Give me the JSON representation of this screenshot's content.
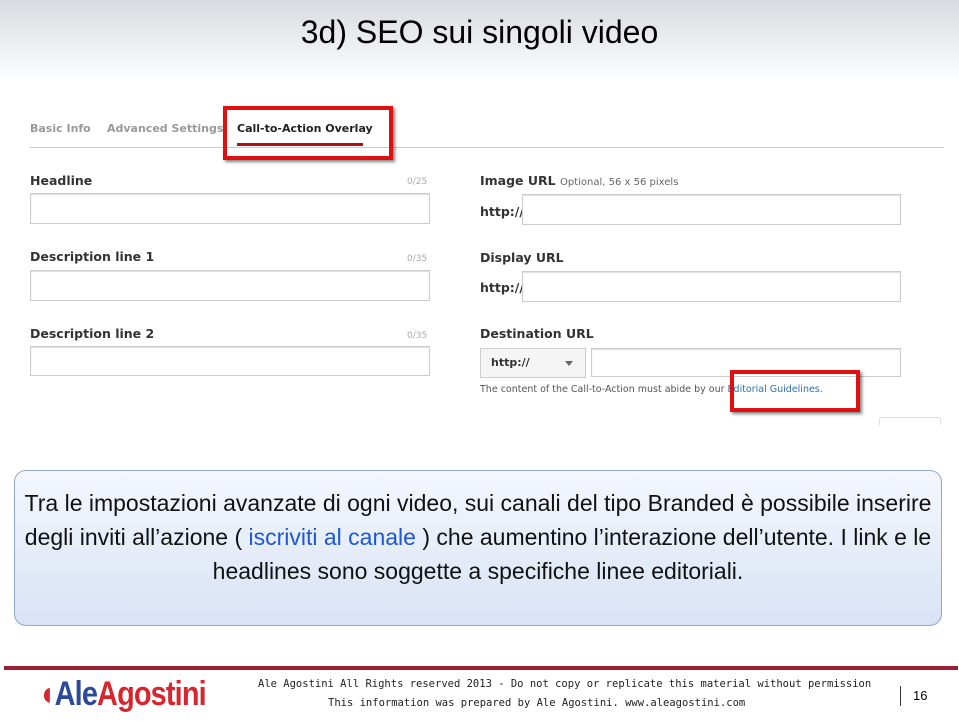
{
  "title": "3d) SEO sui singoli video",
  "screenshot": {
    "tabs": [
      "Basic Info",
      "Advanced Settings",
      "Call-to-Action Overlay"
    ],
    "headline": {
      "label": "Headline",
      "counter": "0/25"
    },
    "desc1": {
      "label": "Description line 1",
      "counter": "0/35"
    },
    "desc2": {
      "label": "Description line 2",
      "counter": "0/35"
    },
    "image_url": {
      "label": "Image URL",
      "hint": "Optional, 56 x 56 pixels",
      "prefix": "http://"
    },
    "display_url": {
      "label": "Display URL",
      "prefix": "http://"
    },
    "destination_url": {
      "label": "Destination URL",
      "select": "http://"
    },
    "note": "The content of the Call-to-Action must abide by our ",
    "note_link": "Editorial Guidelines."
  },
  "callout": {
    "part1": "Tra le impostazioni avanzate di ogni video, sui canali del tipo Branded è possibile inserire degli inviti all’azione ( ",
    "highlight": "iscriviti al canale",
    "part2": " ) che aumentino l’interazione dell’utente. I link e le headlines sono soggette a specifiche linee editoriali."
  },
  "footer": {
    "logo": "AleAgostini",
    "line1": "Ale Agostini All Rights reserved 2013 - Do not copy or replicate this material without permission",
    "line2": "This information  was prepared by Ale Agostini.   www.aleagostini.com",
    "page": "16"
  },
  "colors": {
    "highlight_box": "#e01010",
    "footer_line": "#9c1f35",
    "link": "#2a6fb5"
  }
}
